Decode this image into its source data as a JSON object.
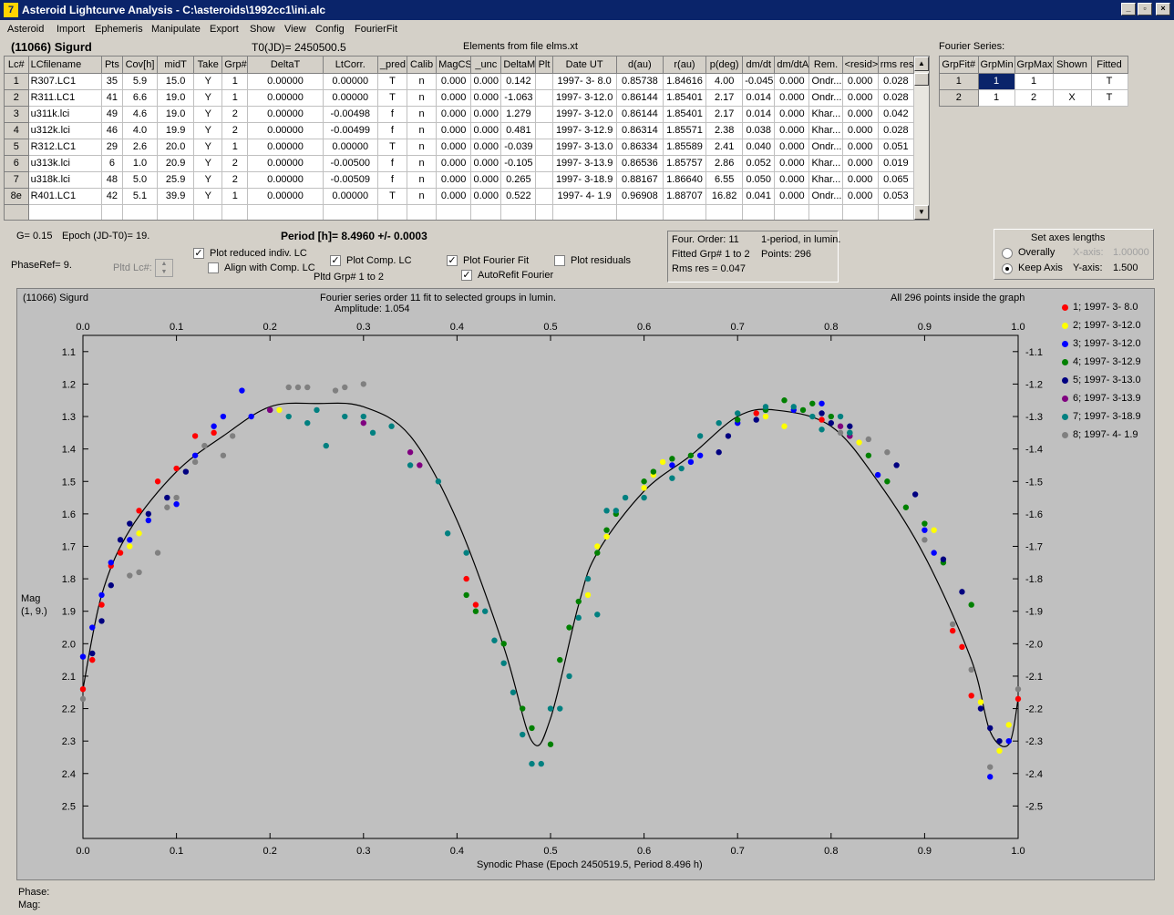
{
  "window": {
    "title": "Asteroid Lightcurve Analysis - C:\\asteroids\\1992cc1\\ini.alc",
    "min": "_",
    "max": "▫",
    "close": "×"
  },
  "menu": [
    "Asteroid",
    "Import",
    "Ephemeris",
    "Manipulate",
    "Export",
    "Show",
    "View",
    "Config",
    "FourierFit"
  ],
  "header": {
    "object": "(11066) Sigurd",
    "t0": "T0(JD)= 2450500.5",
    "elements": "Elements from file elms.xt"
  },
  "table": {
    "columns": [
      "Lc#",
      "LCfilename",
      "Pts",
      "Cov[h]",
      "midT",
      "Take",
      "Grp#",
      "DeltaT",
      "LtCorr.",
      "_pred",
      "Calib",
      "MagCS",
      "_unc",
      "DeltaM",
      "Plt",
      "Date UT",
      "d(au)",
      "r(au)",
      "p(deg)",
      "dm/dt",
      "dm/dtA",
      "Rem.",
      "<resid>",
      "rms res"
    ],
    "rows": [
      [
        "1",
        "R307.LC1",
        "35",
        "5.9",
        "15.0",
        "Y",
        "1",
        "0.00000",
        "0.00000",
        "T",
        "n",
        "0.000",
        "0.000",
        "0.142",
        "",
        "1997- 3- 8.0",
        "0.85738",
        "1.84616",
        "4.00",
        "-0.045",
        "0.000",
        "Ondr...",
        "0.000",
        "0.028"
      ],
      [
        "2",
        "R311.LC1",
        "41",
        "6.6",
        "19.0",
        "Y",
        "1",
        "0.00000",
        "0.00000",
        "T",
        "n",
        "0.000",
        "0.000",
        "-1.063",
        "",
        "1997- 3-12.0",
        "0.86144",
        "1.85401",
        "2.17",
        "0.014",
        "0.000",
        "Ondr...",
        "0.000",
        "0.028"
      ],
      [
        "3",
        "u311k.lci",
        "49",
        "4.6",
        "19.0",
        "Y",
        "2",
        "0.00000",
        "-0.00498",
        "f",
        "n",
        "0.000",
        "0.000",
        "1.279",
        "",
        "1997- 3-12.0",
        "0.86144",
        "1.85401",
        "2.17",
        "0.014",
        "0.000",
        "Khar...",
        "0.000",
        "0.042"
      ],
      [
        "4",
        "u312k.lci",
        "46",
        "4.0",
        "19.9",
        "Y",
        "2",
        "0.00000",
        "-0.00499",
        "f",
        "n",
        "0.000",
        "0.000",
        "0.481",
        "",
        "1997- 3-12.9",
        "0.86314",
        "1.85571",
        "2.38",
        "0.038",
        "0.000",
        "Khar...",
        "0.000",
        "0.028"
      ],
      [
        "5",
        "R312.LC1",
        "29",
        "2.6",
        "20.0",
        "Y",
        "1",
        "0.00000",
        "0.00000",
        "T",
        "n",
        "0.000",
        "0.000",
        "-0.039",
        "",
        "1997- 3-13.0",
        "0.86334",
        "1.85589",
        "2.41",
        "0.040",
        "0.000",
        "Ondr...",
        "0.000",
        "0.051"
      ],
      [
        "6",
        "u313k.lci",
        "6",
        "1.0",
        "20.9",
        "Y",
        "2",
        "0.00000",
        "-0.00500",
        "f",
        "n",
        "0.000",
        "0.000",
        "-0.105",
        "",
        "1997- 3-13.9",
        "0.86536",
        "1.85757",
        "2.86",
        "0.052",
        "0.000",
        "Khar...",
        "0.000",
        "0.019"
      ],
      [
        "7",
        "u318k.lci",
        "48",
        "5.0",
        "25.9",
        "Y",
        "2",
        "0.00000",
        "-0.00509",
        "f",
        "n",
        "0.000",
        "0.000",
        "0.265",
        "",
        "1997- 3-18.9",
        "0.88167",
        "1.86640",
        "6.55",
        "0.050",
        "0.000",
        "Khar...",
        "0.000",
        "0.065"
      ],
      [
        "8e",
        "R401.LC1",
        "42",
        "5.1",
        "39.9",
        "Y",
        "1",
        "0.00000",
        "0.00000",
        "T",
        "n",
        "0.000",
        "0.000",
        "0.522",
        "",
        "1997- 4- 1.9",
        "0.96908",
        "1.88707",
        "16.82",
        "0.041",
        "0.000",
        "Ondr...",
        "0.000",
        "0.053"
      ]
    ]
  },
  "fourier_series": {
    "label": "Fourier Series:",
    "columns": [
      "GrpFit#",
      "GrpMin",
      "GrpMax",
      "Shown",
      "Fitted"
    ],
    "rows": [
      [
        "1",
        "1",
        "1",
        "",
        "T"
      ],
      [
        "2",
        "1",
        "2",
        "X",
        "T"
      ]
    ]
  },
  "info": {
    "g": "G= 0.15",
    "epoch": "Epoch (JD-T0)= 19.",
    "period": "Period [h]= 8.4960 +/- 0.0003",
    "phaseref": "PhaseRef= 9.",
    "pltd_lc": "Pltd Lc#:",
    "pltd_grp": "Pltd Grp#  1   to   2"
  },
  "options": {
    "plot_reduced": "Plot reduced indiv. LC",
    "align_comp": "Align with Comp. LC",
    "plot_comp": "Plot Comp. LC",
    "plot_fourier": "Plot Fourier Fit",
    "autorefit": "AutoRefit Fourier",
    "plot_residuals": "Plot residuals",
    "checked": {
      "plot_reduced": true,
      "align_comp": false,
      "plot_comp": true,
      "plot_fourier": true,
      "autorefit": true,
      "plot_residuals": false
    }
  },
  "fit_summary": {
    "order": "Four. Order: 11",
    "mode": "1-period, in lumin.",
    "fitted": "Fitted Grp# 1 to 2",
    "points": "Points: 296",
    "rms": "Rms res    = 0.047"
  },
  "axes_box": {
    "title": "Set axes lengths",
    "overally": "Overally",
    "keep": "Keep Axis",
    "xaxis_lbl": "X-axis:",
    "xaxis_val": "1.00000",
    "yaxis_lbl": "Y-axis:",
    "yaxis_val": "1.500",
    "selected": "keep"
  },
  "footer": {
    "phase": "Phase:",
    "mag": "Mag:"
  },
  "chart_data": {
    "type": "scatter",
    "title_left": "(11066) Sigurd",
    "title": "Fourier series order 11 fit to selected groups in lumin.",
    "subtitle": "Amplitude: 1.054",
    "title_right": "All 296 points inside the graph",
    "xlabel": "Synodic Phase (Epoch 2450519.5, Period 8.496 h)",
    "ylabel": "Mag",
    "ylabel2": "(1, 9.)",
    "xlim": [
      0,
      1
    ],
    "ylim": [
      1.05,
      2.6
    ],
    "y_inverted": true,
    "xticks": [
      "0.0",
      "0.1",
      "0.2",
      "0.3",
      "0.4",
      "0.5",
      "0.6",
      "0.7",
      "0.8",
      "0.9",
      "1.0"
    ],
    "yticks": [
      "1.1",
      "1.2",
      "1.3",
      "1.4",
      "1.5",
      "1.6",
      "1.7",
      "1.8",
      "1.9",
      "2.0",
      "2.1",
      "2.2",
      "2.3",
      "2.4",
      "2.5"
    ],
    "grid": false,
    "legend_position": "right",
    "fit_curve": [
      [
        0,
        2.14
      ],
      [
        0.02,
        1.85
      ],
      [
        0.05,
        1.65
      ],
      [
        0.1,
        1.47
      ],
      [
        0.15,
        1.36
      ],
      [
        0.2,
        1.27
      ],
      [
        0.25,
        1.26
      ],
      [
        0.3,
        1.27
      ],
      [
        0.35,
        1.36
      ],
      [
        0.4,
        1.62
      ],
      [
        0.45,
        2.01
      ],
      [
        0.48,
        2.3
      ],
      [
        0.5,
        2.23
      ],
      [
        0.53,
        1.88
      ],
      [
        0.55,
        1.72
      ],
      [
        0.6,
        1.53
      ],
      [
        0.65,
        1.42
      ],
      [
        0.7,
        1.3
      ],
      [
        0.74,
        1.28
      ],
      [
        0.8,
        1.33
      ],
      [
        0.85,
        1.5
      ],
      [
        0.9,
        1.73
      ],
      [
        0.95,
        2.05
      ],
      [
        0.97,
        2.27
      ],
      [
        0.99,
        2.31
      ],
      [
        1.0,
        2.17
      ]
    ],
    "series": [
      {
        "name": "1; 1997- 3- 8.0",
        "color": "#ff0000",
        "points": [
          [
            0,
            2.14
          ],
          [
            0.01,
            2.05
          ],
          [
            0.02,
            1.88
          ],
          [
            0.03,
            1.76
          ],
          [
            0.04,
            1.72
          ],
          [
            0.06,
            1.59
          ],
          [
            0.08,
            1.5
          ],
          [
            0.1,
            1.46
          ],
          [
            0.12,
            1.36
          ],
          [
            0.14,
            1.35
          ],
          [
            0.41,
            1.8
          ],
          [
            0.42,
            1.88
          ],
          [
            0.72,
            1.29
          ],
          [
            0.79,
            1.31
          ],
          [
            0.82,
            1.36
          ],
          [
            0.93,
            1.96
          ],
          [
            0.94,
            2.01
          ],
          [
            0.95,
            2.16
          ],
          [
            1.0,
            2.17
          ]
        ]
      },
      {
        "name": "2; 1997- 3-12.0",
        "color": "#ffff00",
        "points": [
          [
            0.05,
            1.7
          ],
          [
            0.06,
            1.66
          ],
          [
            0.2,
            1.28
          ],
          [
            0.21,
            1.28
          ],
          [
            0.54,
            1.85
          ],
          [
            0.55,
            1.7
          ],
          [
            0.56,
            1.67
          ],
          [
            0.6,
            1.52
          ],
          [
            0.61,
            1.48
          ],
          [
            0.62,
            1.44
          ],
          [
            0.73,
            1.3
          ],
          [
            0.75,
            1.33
          ],
          [
            0.83,
            1.38
          ],
          [
            0.91,
            1.65
          ],
          [
            0.96,
            2.18
          ],
          [
            0.98,
            2.33
          ],
          [
            0.99,
            2.25
          ]
        ]
      },
      {
        "name": "3; 1997- 3-12.0",
        "color": "#0000ff",
        "points": [
          [
            0,
            2.04
          ],
          [
            0.01,
            1.95
          ],
          [
            0.02,
            1.85
          ],
          [
            0.03,
            1.75
          ],
          [
            0.05,
            1.68
          ],
          [
            0.07,
            1.62
          ],
          [
            0.1,
            1.57
          ],
          [
            0.12,
            1.42
          ],
          [
            0.14,
            1.33
          ],
          [
            0.15,
            1.3
          ],
          [
            0.17,
            1.22
          ],
          [
            0.18,
            1.3
          ],
          [
            0.2,
            1.28
          ],
          [
            0.63,
            1.45
          ],
          [
            0.65,
            1.44
          ],
          [
            0.66,
            1.42
          ],
          [
            0.7,
            1.32
          ],
          [
            0.73,
            1.28
          ],
          [
            0.76,
            1.28
          ],
          [
            0.79,
            1.26
          ],
          [
            0.85,
            1.48
          ],
          [
            0.9,
            1.65
          ],
          [
            0.91,
            1.72
          ],
          [
            0.97,
            2.41
          ],
          [
            0.99,
            2.3
          ]
        ]
      },
      {
        "name": "4; 1997- 3-12.9",
        "color": "#008000",
        "points": [
          [
            0.41,
            1.85
          ],
          [
            0.42,
            1.9
          ],
          [
            0.45,
            2.0
          ],
          [
            0.47,
            2.2
          ],
          [
            0.48,
            2.26
          ],
          [
            0.5,
            2.31
          ],
          [
            0.51,
            2.05
          ],
          [
            0.52,
            1.95
          ],
          [
            0.53,
            1.87
          ],
          [
            0.55,
            1.72
          ],
          [
            0.56,
            1.65
          ],
          [
            0.57,
            1.6
          ],
          [
            0.6,
            1.5
          ],
          [
            0.61,
            1.47
          ],
          [
            0.63,
            1.43
          ],
          [
            0.65,
            1.42
          ],
          [
            0.7,
            1.31
          ],
          [
            0.73,
            1.28
          ],
          [
            0.75,
            1.25
          ],
          [
            0.77,
            1.28
          ],
          [
            0.78,
            1.26
          ],
          [
            0.8,
            1.3
          ],
          [
            0.82,
            1.35
          ],
          [
            0.84,
            1.42
          ],
          [
            0.86,
            1.5
          ],
          [
            0.88,
            1.58
          ],
          [
            0.9,
            1.63
          ],
          [
            0.92,
            1.75
          ],
          [
            0.95,
            1.88
          ]
        ]
      },
      {
        "name": "5; 1997- 3-13.0",
        "color": "#000080",
        "points": [
          [
            0.01,
            2.03
          ],
          [
            0.02,
            1.93
          ],
          [
            0.03,
            1.82
          ],
          [
            0.04,
            1.68
          ],
          [
            0.05,
            1.63
          ],
          [
            0.07,
            1.6
          ],
          [
            0.09,
            1.55
          ],
          [
            0.11,
            1.47
          ],
          [
            0.68,
            1.41
          ],
          [
            0.69,
            1.36
          ],
          [
            0.72,
            1.31
          ],
          [
            0.79,
            1.29
          ],
          [
            0.8,
            1.32
          ],
          [
            0.82,
            1.33
          ],
          [
            0.87,
            1.45
          ],
          [
            0.89,
            1.54
          ],
          [
            0.92,
            1.74
          ],
          [
            0.94,
            1.84
          ],
          [
            0.96,
            2.2
          ],
          [
            0.97,
            2.26
          ],
          [
            0.98,
            2.3
          ]
        ]
      },
      {
        "name": "6; 1997- 3-13.9",
        "color": "#800080",
        "points": [
          [
            0.2,
            1.28
          ],
          [
            0.3,
            1.32
          ],
          [
            0.35,
            1.41
          ],
          [
            0.36,
            1.45
          ],
          [
            0.81,
            1.33
          ],
          [
            0.82,
            1.36
          ]
        ]
      },
      {
        "name": "7; 1997- 3-18.9",
        "color": "#008080",
        "points": [
          [
            0.22,
            1.3
          ],
          [
            0.24,
            1.32
          ],
          [
            0.25,
            1.28
          ],
          [
            0.26,
            1.39
          ],
          [
            0.28,
            1.3
          ],
          [
            0.3,
            1.3
          ],
          [
            0.31,
            1.35
          ],
          [
            0.33,
            1.33
          ],
          [
            0.35,
            1.45
          ],
          [
            0.38,
            1.5
          ],
          [
            0.39,
            1.66
          ],
          [
            0.41,
            1.72
          ],
          [
            0.43,
            1.9
          ],
          [
            0.44,
            1.99
          ],
          [
            0.45,
            2.06
          ],
          [
            0.46,
            2.15
          ],
          [
            0.47,
            2.28
          ],
          [
            0.48,
            2.37
          ],
          [
            0.49,
            2.37
          ],
          [
            0.5,
            2.2
          ],
          [
            0.51,
            2.2
          ],
          [
            0.52,
            2.1
          ],
          [
            0.53,
            1.92
          ],
          [
            0.54,
            1.8
          ],
          [
            0.55,
            1.91
          ],
          [
            0.56,
            1.59
          ],
          [
            0.57,
            1.59
          ],
          [
            0.58,
            1.55
          ],
          [
            0.6,
            1.55
          ],
          [
            0.63,
            1.49
          ],
          [
            0.64,
            1.46
          ],
          [
            0.66,
            1.36
          ],
          [
            0.68,
            1.32
          ],
          [
            0.7,
            1.29
          ],
          [
            0.73,
            1.27
          ],
          [
            0.76,
            1.27
          ],
          [
            0.78,
            1.3
          ],
          [
            0.79,
            1.34
          ],
          [
            0.81,
            1.3
          ],
          [
            0.82,
            1.35
          ]
        ]
      },
      {
        "name": "8; 1997- 4- 1.9",
        "color": "#808080",
        "points": [
          [
            0,
            2.17
          ],
          [
            0.05,
            1.79
          ],
          [
            0.06,
            1.78
          ],
          [
            0.08,
            1.72
          ],
          [
            0.09,
            1.58
          ],
          [
            0.1,
            1.55
          ],
          [
            0.12,
            1.44
          ],
          [
            0.13,
            1.39
          ],
          [
            0.15,
            1.42
          ],
          [
            0.16,
            1.36
          ],
          [
            0.22,
            1.21
          ],
          [
            0.23,
            1.21
          ],
          [
            0.24,
            1.21
          ],
          [
            0.27,
            1.22
          ],
          [
            0.28,
            1.21
          ],
          [
            0.3,
            1.2
          ],
          [
            0.81,
            1.35
          ],
          [
            0.84,
            1.37
          ],
          [
            0.86,
            1.41
          ],
          [
            0.9,
            1.68
          ],
          [
            0.93,
            1.94
          ],
          [
            0.95,
            2.08
          ],
          [
            0.97,
            2.38
          ],
          [
            1.0,
            2.14
          ]
        ]
      }
    ]
  }
}
